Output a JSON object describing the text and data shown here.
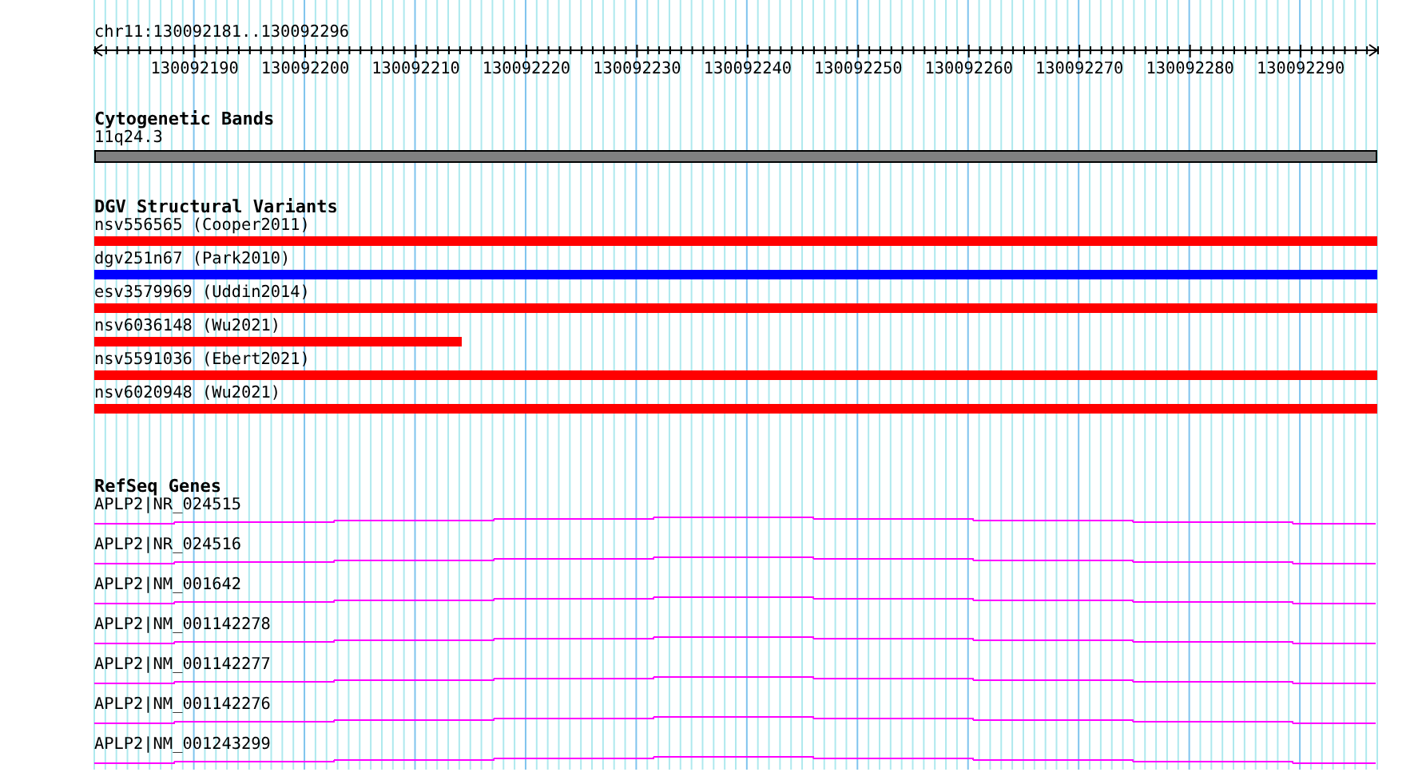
{
  "ruler": {
    "location": "chr11:130092181..130092296",
    "tick_labels": [
      "130092190",
      "130092200",
      "130092210",
      "130092220",
      "130092230",
      "130092240",
      "130092250",
      "130092260",
      "130092270",
      "130092280",
      "130092290"
    ]
  },
  "cytogenetic_bands": {
    "title": "Cytogenetic Bands",
    "bands": [
      {
        "label": "11q24.3"
      }
    ]
  },
  "dgv_structural_variants": {
    "title": "DGV Structural Variants",
    "variants": [
      {
        "label": "nsv556565 (Cooper2011)",
        "color": "#ff0000",
        "kind": "full"
      },
      {
        "label": "dgv251n67 (Park2010)",
        "color": "#0000ff",
        "kind": "full"
      },
      {
        "label": "esv3579969 (Uddin2014)",
        "color": "#ff0000",
        "kind": "full"
      },
      {
        "label": "nsv6036148 (Wu2021)",
        "color": "#ff0000",
        "kind": "partial"
      },
      {
        "label": "nsv5591036 (Ebert2021)",
        "color": "#ff0000",
        "kind": "full"
      },
      {
        "label": "nsv6020948 (Wu2021)",
        "color": "#ff0000",
        "kind": "full"
      }
    ]
  },
  "refseq_genes": {
    "title": "RefSeq Genes",
    "transcripts": [
      "APLP2|NR_024515",
      "APLP2|NR_024516",
      "APLP2|NM_001642",
      "APLP2|NM_001142278",
      "APLP2|NM_001142277",
      "APLP2|NM_001142276",
      "APLP2|NM_001243299"
    ]
  }
}
